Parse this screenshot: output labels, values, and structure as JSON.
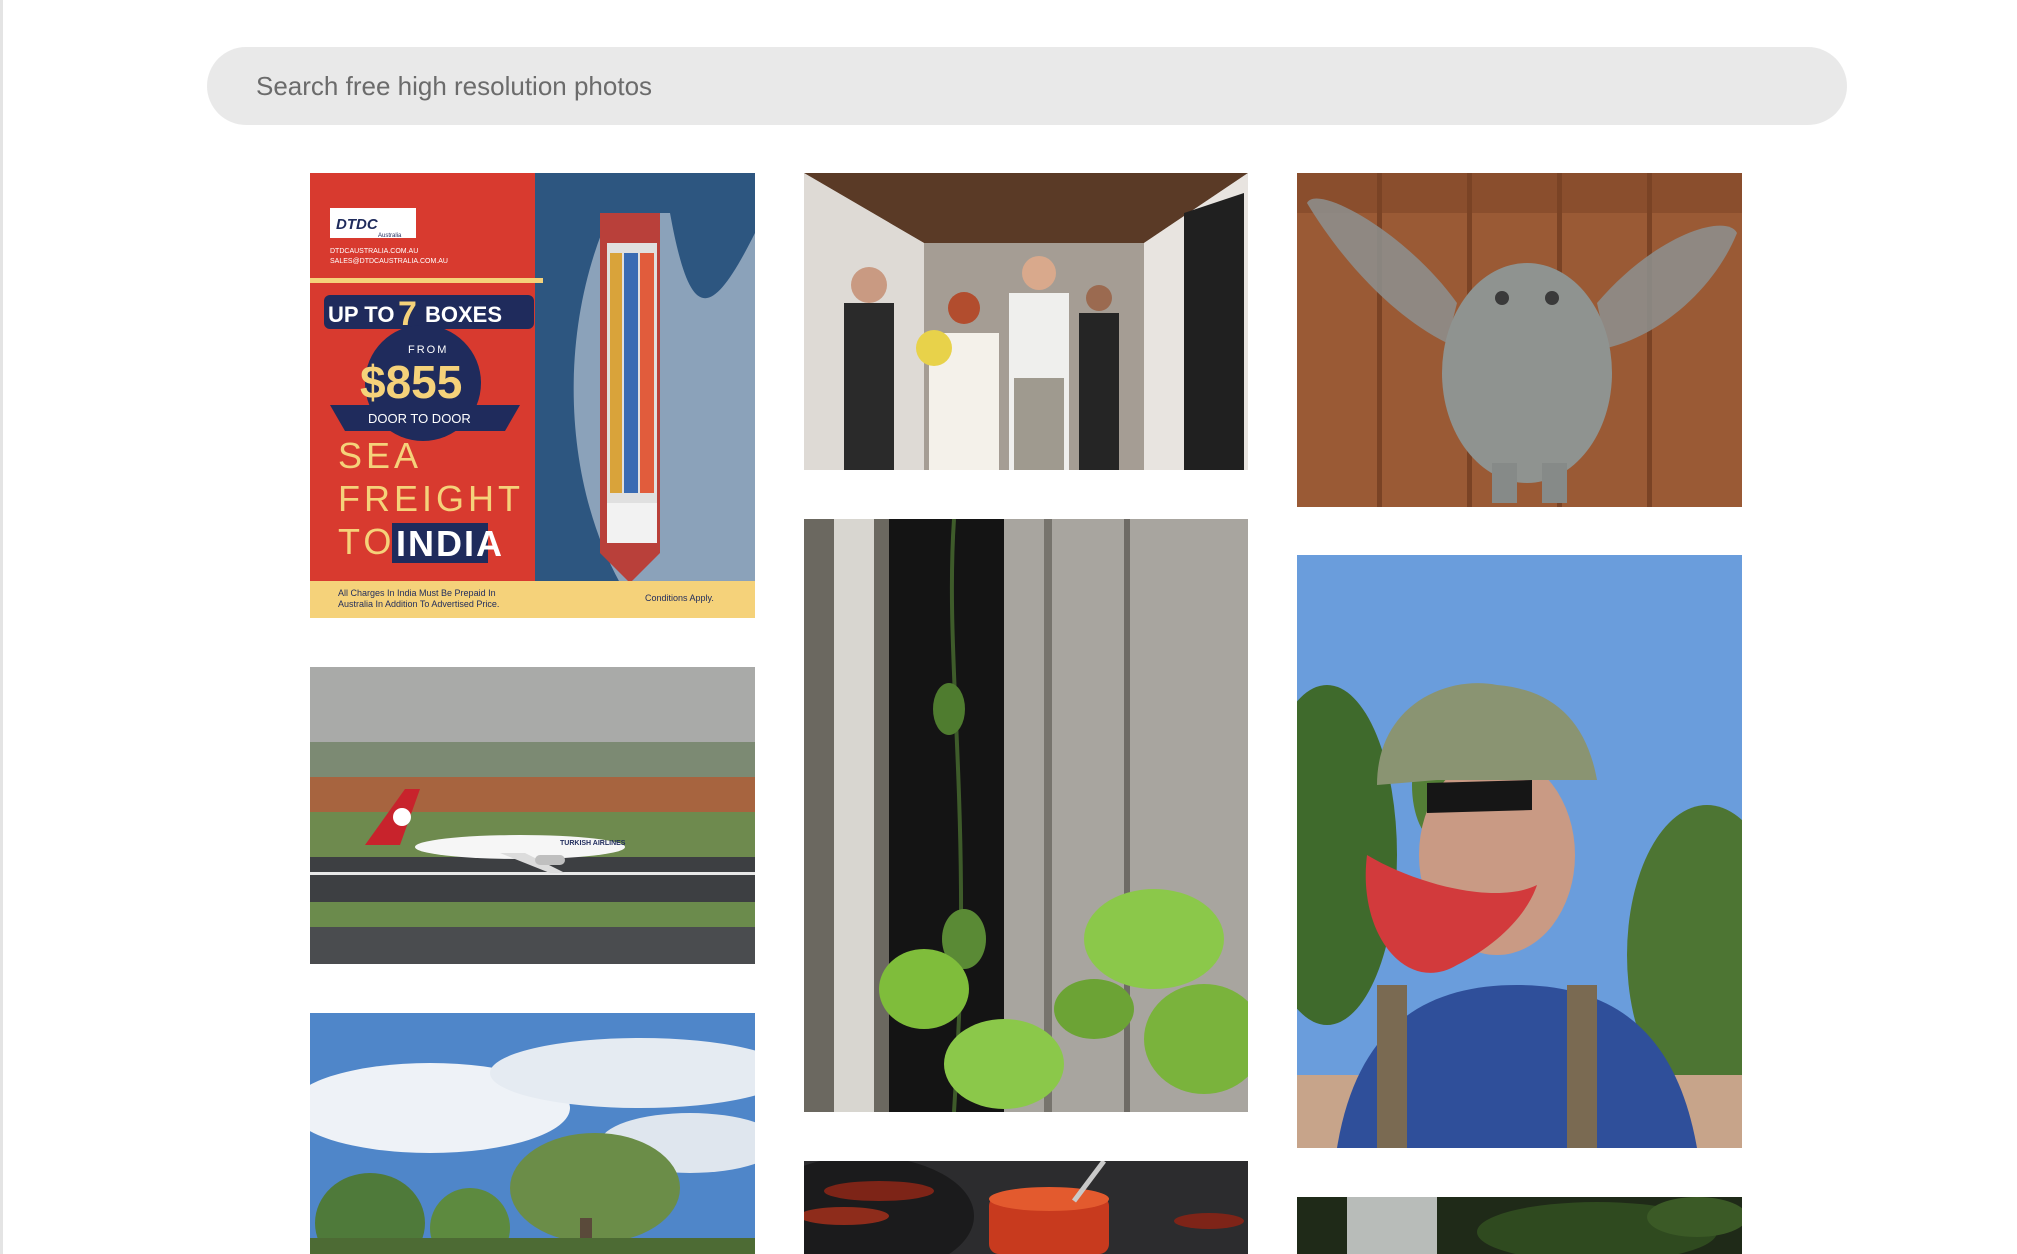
{
  "search": {
    "placeholder": "Search free high resolution photos",
    "value": ""
  },
  "gallery": {
    "photos": [
      {
        "id": "dtdc-ad",
        "subject": "advertisement with container ship",
        "text": {
          "brand": "DTDC",
          "brand_sub": "Australia",
          "website": "DTDCAUSTRALIA.COM.AU",
          "email": "SALES@DTDCAUSTRALIA.COM.AU",
          "up_to_1": "UP TO",
          "up_to_num": "7",
          "up_to_2": "BOXES",
          "from": "FROM",
          "price": "$855",
          "door": "DOOR TO DOOR",
          "line1": "SEA",
          "line2": "FREIGHT",
          "line3a": "TO",
          "line3b": "INDIA",
          "footnote1": "All Charges In India Must Be Prepaid In",
          "footnote2": "Australia In Addition To Advertised Price.",
          "conditions": "Conditions Apply."
        }
      },
      {
        "id": "airplane",
        "subject": "airplane on runway",
        "livery_text": "TURKISH AIRLINES"
      },
      {
        "id": "trees-sky",
        "subject": "trees under cloudy blue sky"
      },
      {
        "id": "wedding",
        "subject": "wedding couple walking down hallway"
      },
      {
        "id": "wood-plant",
        "subject": "weathered wood with green plant"
      },
      {
        "id": "chili-jar",
        "subject": "dried chilies and jar of jam"
      },
      {
        "id": "wire-owl",
        "subject": "wire mesh owl sculpture on wooden deck"
      },
      {
        "id": "hiker-selfie",
        "subject": "man with cap and sunglasses selfie"
      },
      {
        "id": "dark-partial",
        "subject": "dark green partial image"
      }
    ]
  },
  "colors": {
    "search_bg": "#e9e9e9",
    "ad_red": "#d83a2f",
    "ad_navy": "#1f2b5c",
    "ad_yellow": "#f5d27a"
  }
}
